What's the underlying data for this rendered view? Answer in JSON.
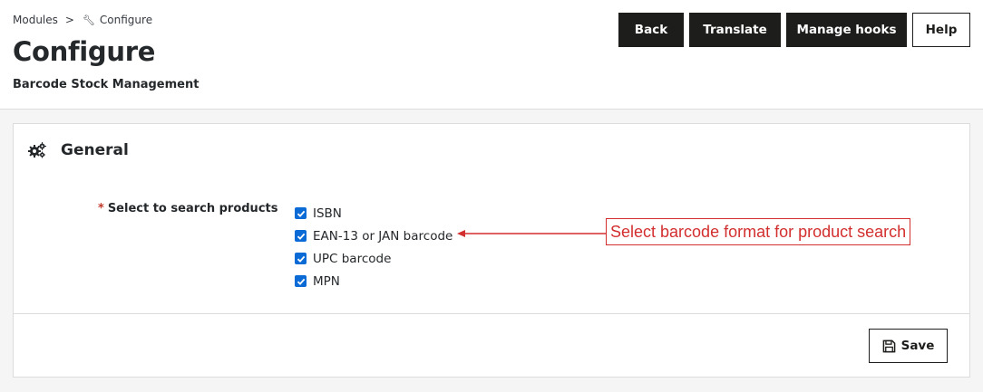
{
  "breadcrumb": {
    "root": "Modules",
    "separator": ">",
    "current_icon": "wrench-icon",
    "current": "Configure"
  },
  "header": {
    "title": "Configure",
    "subtitle": "Barcode Stock Management"
  },
  "toolbar": {
    "back_label": "Back",
    "translate_label": "Translate",
    "manage_hooks_label": "Manage hooks",
    "help_label": "Help"
  },
  "panel": {
    "icon": "gears-icon",
    "title": "General",
    "form": {
      "required_marker": "*",
      "label": "Select to search products",
      "options": [
        {
          "label": "ISBN",
          "checked": true
        },
        {
          "label": "EAN-13 or JAN barcode",
          "checked": true
        },
        {
          "label": "UPC barcode",
          "checked": true
        },
        {
          "label": "MPN",
          "checked": true
        }
      ]
    },
    "annotation": {
      "text": "Select barcode format for product search",
      "color": "#d32f2f"
    },
    "footer": {
      "save_label": "Save",
      "save_icon": "floppy-disk-icon"
    }
  },
  "colors": {
    "checkbox": "#0b6bd6",
    "dark_button": "#1d1d1b",
    "required": "#c0392b"
  }
}
